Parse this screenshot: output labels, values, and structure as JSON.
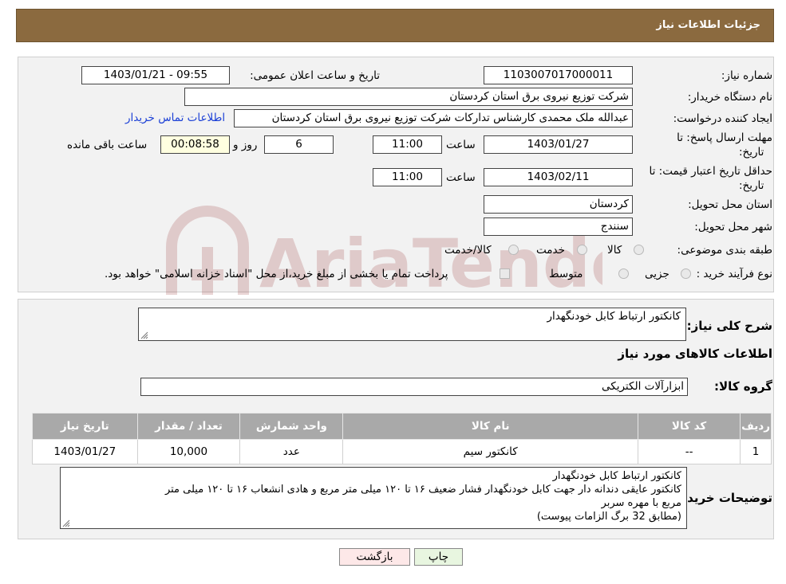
{
  "header": {
    "title": "جزئیات اطلاعات نیاز"
  },
  "form": {
    "need_number_label": "شماره نیاز:",
    "need_number": "1103007017000011",
    "announce_label": "تاریخ و ساعت اعلان عمومی:",
    "announce_value": "1403/01/21 - 09:55",
    "buyer_org_label": "نام دستگاه خریدار:",
    "buyer_org": "شرکت توزیع نیروی برق استان کردستان",
    "creator_label": "ایجاد کننده درخواست:",
    "creator": "عبدالله ملک محمدی کارشناس تدارکات شرکت توزیع نیروی برق استان کردستان",
    "contact_link": "اطلاعات تماس خریدار",
    "deadline_label_1": "مهلت ارسال پاسخ: تا",
    "deadline_label_2": "تاریخ:",
    "deadline_date": "1403/01/27",
    "time_label": "ساعت",
    "deadline_time": "11:00",
    "days_value": "6",
    "days_label": "روز و",
    "remaining_time": "00:08:58",
    "remaining_label": "ساعت باقی مانده",
    "validity_label_1": "حداقل تاریخ اعتبار قیمت: تا",
    "validity_label_2": "تاریخ:",
    "validity_date": "1403/02/11",
    "validity_time": "11:00",
    "province_label": "استان محل تحویل:",
    "province": "کردستان",
    "city_label": "شهر محل تحویل:",
    "city": "سنندج",
    "category_label": "طبقه بندی موضوعی:",
    "category_options": [
      "کالا",
      "خدمت",
      "کالا/خدمت"
    ],
    "process_label": "نوع فرآیند خرید :",
    "process_options": [
      "جزیی",
      "متوسط"
    ],
    "payment_note": "پرداخت تمام یا بخشی از مبلغ خرید،از محل \"اسناد خزانه اسلامی\" خواهد بود."
  },
  "details": {
    "general_desc_label": "شرح کلی نیاز:",
    "general_desc": "کانکتور ارتباط کابل خودنگهدار",
    "goods_info_title": "اطلاعات کالاهای مورد نیاز",
    "goods_group_label": "گروه کالا:",
    "goods_group": "ابزارآلات الکتریکی",
    "table": {
      "headers": [
        "ردیف",
        "کد کالا",
        "نام کالا",
        "واحد شمارش",
        "تعداد / مقدار",
        "تاریخ نیاز"
      ],
      "rows": [
        [
          "1",
          "--",
          "کانکتور سیم",
          "عدد",
          "10,000",
          "1403/01/27"
        ]
      ]
    },
    "buyer_notes_label": "توضیحات خریدار:",
    "buyer_notes": [
      "کانکتور ارتباط کابل خودنگهدار",
      "کانکتور عایقی دندانه دار جهت کابل خودنگهدار فشار ضعیف ۱۶ تا ۱۲۰ میلی متر مربع و هادی انشعاب ۱۶ تا ۱۲۰ میلی متر",
      "مربع با مهره سربر",
      "(مطابق 32 برگ الزامات  پیوست)"
    ]
  },
  "buttons": {
    "print": "چاپ",
    "back": "بازگشت"
  },
  "watermark_text": "AriaTender.neT",
  "colors": {
    "header_bg": "#8b6a3f",
    "panel_bg": "#f2f2f2",
    "table_header": "#a9a9a9",
    "link": "#1a3fd6",
    "back_button": "#fde8e8",
    "print_button": "#e8f6e0",
    "countdown_bg": "#ffffe0"
  }
}
